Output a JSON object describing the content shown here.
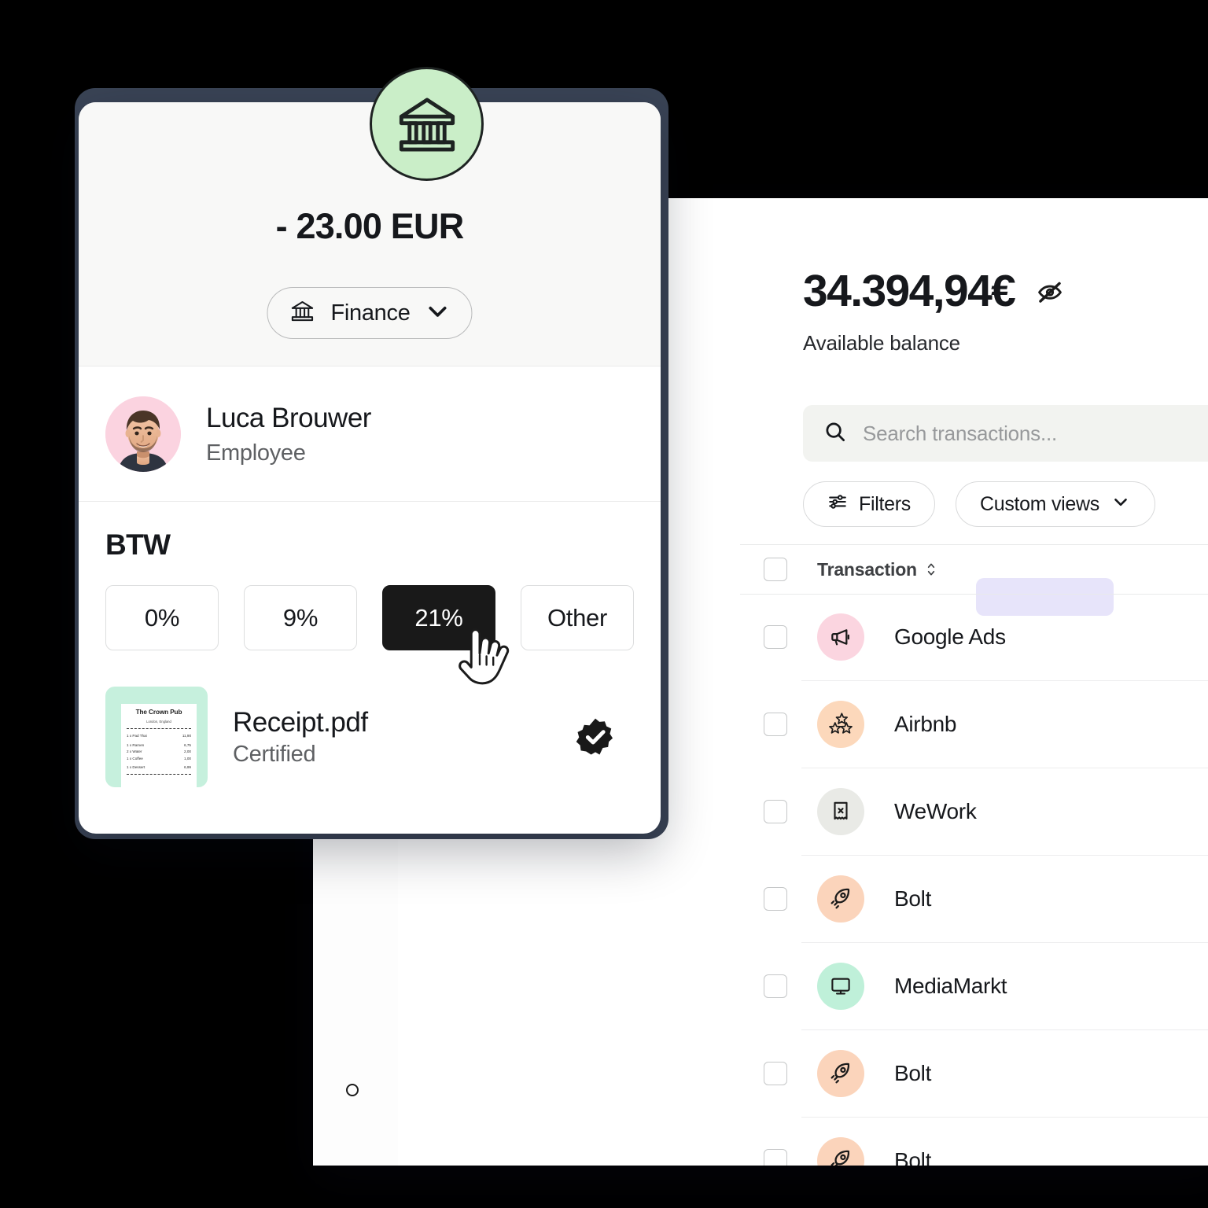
{
  "transactions_panel": {
    "balance": {
      "amount": "34.394,94€",
      "label": "Available balance",
      "hide_icon": "eye-off-icon"
    },
    "search": {
      "placeholder": "Search transactions...",
      "value": "",
      "icon": "search-icon"
    },
    "filters_button": {
      "label": "Filters",
      "icon": "sliders-icon"
    },
    "custom_views_button": {
      "label": "Custom views",
      "icon": "chevron-down-icon"
    },
    "table": {
      "column_header": "Transaction",
      "sort_icon": "sort-updown-icon",
      "rows": [
        {
          "name": "Google Ads",
          "icon": "megaphone-icon",
          "icon_bg": "#fbd5e0"
        },
        {
          "name": "Airbnb",
          "icon": "stars-icon",
          "icon_bg": "#fcd8bb"
        },
        {
          "name": "WeWork",
          "icon": "receipt-x-icon",
          "icon_bg": "#e9eae6"
        },
        {
          "name": "Bolt",
          "icon": "rocket-icon",
          "icon_bg": "#fbd4bb"
        },
        {
          "name": "MediaMarkt",
          "icon": "monitor-icon",
          "icon_bg": "#bff0d9"
        },
        {
          "name": "Bolt",
          "icon": "rocket-icon",
          "icon_bg": "#fbd4bb"
        },
        {
          "name": "Bolt",
          "icon": "rocket-icon",
          "icon_bg": "#fbd4bb"
        }
      ]
    }
  },
  "detail_card": {
    "bank_icon": "bank-building-icon",
    "amount": "- 23.00 EUR",
    "category": {
      "label": "Finance",
      "icon": "bank-icon",
      "chevron": "chevron-down-icon"
    },
    "person": {
      "name": "Luca Brouwer",
      "role": "Employee",
      "avatar": "avatar-photo"
    },
    "vat": {
      "title": "BTW",
      "options": [
        "0%",
        "9%",
        "21%",
        "Other"
      ],
      "selected": "21%"
    },
    "attachment": {
      "name": "Receipt.pdf",
      "status": "Certified",
      "badge_icon": "certified-check-icon",
      "thumbnail": {
        "title": "The Crown Pub",
        "subtitle": "London, England",
        "items": [
          {
            "label": "1 x Pad Thai",
            "price": "11,90"
          },
          {
            "label": "1 x Ramen",
            "price": "6,75"
          },
          {
            "label": "2 x Water",
            "price": "2,00"
          },
          {
            "label": "1 x Coffee",
            "price": "1,00"
          },
          {
            "label": "1 x Dessert",
            "price": "6,99"
          }
        ]
      }
    },
    "cursor": "pointing-hand-cursor"
  },
  "colors": {
    "accent_green": "#caeec8",
    "selected_dark": "#191919",
    "purple_chip": "#e7e4fa",
    "card_header_bg": "#f8f8f7"
  }
}
